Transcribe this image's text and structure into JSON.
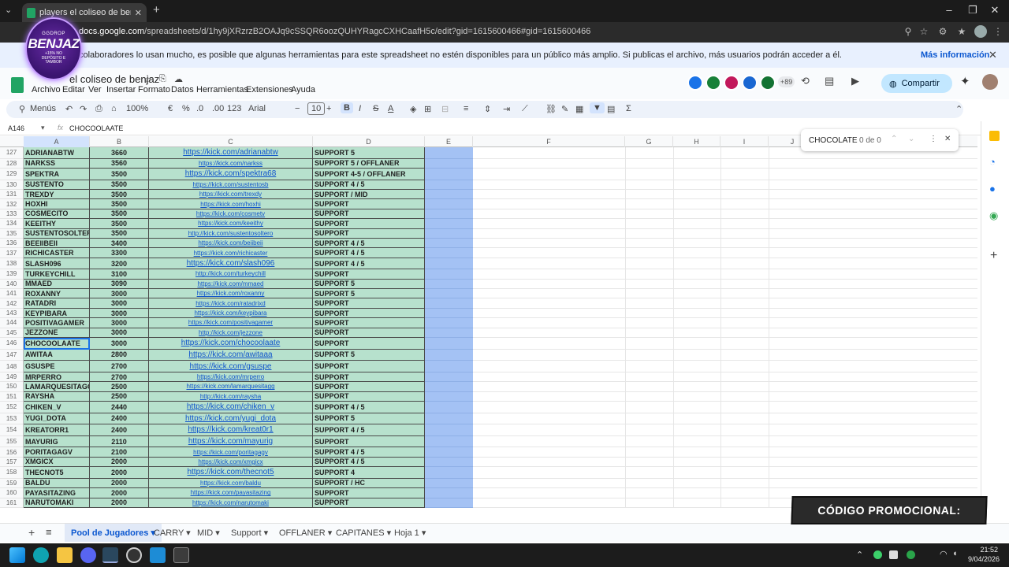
{
  "browser": {
    "tab_title": "players el coliseo de benjaz - Hoja",
    "url_host": "docs.google.com",
    "url_path": "/spreadsheets/d/1hy9jXRzrzB2OAJq9cSSQR6oozQUHYRagcCXHCaafH5c/edit?gid=1615600466#gid=1615600466"
  },
  "banner": {
    "message": "colaboradores lo usan mucho, es posible que algunas herramientas para este spreadsheet no estén disponibles para un público más amplio. Si publicas el archivo, más usuarios podrán acceder a él.",
    "more_link": "Más información"
  },
  "doc": {
    "title": "el coliseo de benjaz",
    "menus": [
      "Archivo",
      "Editar",
      "Ver",
      "Insertar",
      "Formato",
      "Datos",
      "Herramientas",
      "Extensiones",
      "Ayuda"
    ],
    "presence_more": "+89",
    "share_label": "Compartir"
  },
  "toolbar": {
    "menus_label": "Menús",
    "zoom": "100%",
    "currency": "€",
    "percent": "%",
    "dec_less": ".0",
    "dec_more": ".00",
    "format123": "123",
    "font": "Arial",
    "font_size": "10"
  },
  "formula": {
    "cell_ref": "A146",
    "value": "CHOCOOLAATE"
  },
  "columns": [
    "A",
    "B",
    "C",
    "D",
    "E",
    "F",
    "G",
    "H",
    "I",
    "J"
  ],
  "find": {
    "query": "CHOCOLATE",
    "count": "0 de 0"
  },
  "rows": [
    {
      "n": "127",
      "a": "ADRIANABTW",
      "b": "3660",
      "c": "https://kick.com/adrianabtw",
      "d": "SUPPORT 5",
      "big": true
    },
    {
      "n": "128",
      "a": "NARKSS",
      "b": "3560",
      "c": "https://kick.com/narkss",
      "d": "SUPPORT 5 / OFFLANER",
      "big": false
    },
    {
      "n": "129",
      "a": "SPEKTRA",
      "b": "3500",
      "c": "https://kick.com/spektra68",
      "d": "SUPPORT 4-5 / OFFLANER",
      "big": true
    },
    {
      "n": "130",
      "a": "SUSTENTO",
      "b": "3500",
      "c": "https://kick.com/sustentosb",
      "d": "SUPPORT 4 / 5",
      "big": false
    },
    {
      "n": "131",
      "a": "TREXDY",
      "b": "3500",
      "c": "https://kick.com/trexdy",
      "d": "SUPPORT / MID",
      "big": false
    },
    {
      "n": "132",
      "a": "HOXHI",
      "b": "3500",
      "c": "https://kick.com/hoxhi",
      "d": "SUPPORT",
      "big": false
    },
    {
      "n": "133",
      "a": "COSMECITO",
      "b": "3500",
      "c": "https://kick.com/cosmetv",
      "d": "SUPPORT",
      "big": false
    },
    {
      "n": "134",
      "a": "KEEITHY",
      "b": "3500",
      "c": "https://kick.com/keeithy",
      "d": "SUPPORT",
      "big": false
    },
    {
      "n": "135",
      "a": "SUSTENTOSOLTERO",
      "b": "3500",
      "c": "http://kick.com/sustentosoltero",
      "d": "SUPPORT",
      "big": false
    },
    {
      "n": "136",
      "a": "BEEIIBEII",
      "b": "3400",
      "c": "https://kick.com/beiibeii",
      "d": "SUPPORT 4 / 5",
      "big": false
    },
    {
      "n": "137",
      "a": "RICHICASTER",
      "b": "3300",
      "c": "https://kick.com/richicaster",
      "d": "SUPPORT 4 / 5",
      "big": false
    },
    {
      "n": "138",
      "a": "SLASH096",
      "b": "3200",
      "c": "https://kick.com/slash096",
      "d": "SUPPORT 4 / 5",
      "big": true
    },
    {
      "n": "139",
      "a": "TURKEYCHILL",
      "b": "3100",
      "c": "http://kick.com/turkeychill",
      "d": "SUPPORT",
      "big": false
    },
    {
      "n": "140",
      "a": "MMAED",
      "b": "3090",
      "c": "https://kick.com/mmaed",
      "d": "SUPPORT 5",
      "big": false
    },
    {
      "n": "141",
      "a": "ROXANNY",
      "b": "3000",
      "c": "https://kick.com/roxanny",
      "d": "SUPPORT 5",
      "big": false
    },
    {
      "n": "142",
      "a": "RATADRI",
      "b": "3000",
      "c": "https://kick.com/ratadrixd",
      "d": "SUPPORT",
      "big": false
    },
    {
      "n": "143",
      "a": "KEYPIBARA",
      "b": "3000",
      "c": "https://kick.com/keypibara",
      "d": "SUPPORT",
      "big": false
    },
    {
      "n": "144",
      "a": "POSITIVAGAMER",
      "b": "3000",
      "c": "https://kick.com/positivagamer",
      "d": "SUPPORT",
      "big": false
    },
    {
      "n": "145",
      "a": "JEZZONE",
      "b": "3000",
      "c": "http://kick.com/jezzone",
      "d": "SUPPORT",
      "big": false
    },
    {
      "n": "146",
      "a": "CHOCOOLAATE",
      "b": "3000",
      "c": "https://kick.com/chocoolaate",
      "d": "SUPPORT",
      "big": true,
      "selected": true
    },
    {
      "n": "147",
      "a": "AWITAA",
      "b": "2800",
      "c": "https://kick.com/awitaaa",
      "d": "SUPPORT 5",
      "big": true
    },
    {
      "n": "148",
      "a": "GSUSPE",
      "b": "2700",
      "c": "https://kick.com/gsuspe",
      "d": "SUPPORT",
      "big": true
    },
    {
      "n": "149",
      "a": "MRPERRO",
      "b": "2700",
      "c": "https://kick.com/mrperro",
      "d": "SUPPORT",
      "big": false
    },
    {
      "n": "150",
      "a": "LAMARQUESITAGG",
      "b": "2500",
      "c": "https://kick.com/lamarquesitagg",
      "d": "SUPPORT",
      "big": false
    },
    {
      "n": "151",
      "a": "RAYSHA",
      "b": "2500",
      "c": "http://kick.com/raysha",
      "d": "SUPPORT",
      "big": false
    },
    {
      "n": "152",
      "a": "CHIKEN_V",
      "b": "2440",
      "c": "https://kick.com/chiken_v",
      "d": "SUPPORT 4 / 5",
      "big": true
    },
    {
      "n": "153",
      "a": "YUGI_DOTA",
      "b": "2400",
      "c": "https://kick.com/yugi_dota",
      "d": "SUPPORT 5",
      "big": true
    },
    {
      "n": "154",
      "a": "KREATORR1",
      "b": "2400",
      "c": "https://kick.com/kreat0r1",
      "d": "SUPPORT 4 / 5",
      "big": true
    },
    {
      "n": "155",
      "a": "MAYURIG",
      "b": "2110",
      "c": "https://kick.com/mayurig",
      "d": "SUPPORT",
      "big": true
    },
    {
      "n": "156",
      "a": "PORITAGAGV",
      "b": "2100",
      "c": "https://kick.com/poritagagv",
      "d": "SUPPORT 4 / 5",
      "big": false
    },
    {
      "n": "157",
      "a": "XMGICX",
      "b": "2000",
      "c": "https://kick.com/xmgicx",
      "d": "SUPPORT 4 / 5",
      "big": false
    },
    {
      "n": "158",
      "a": "THECNOT5",
      "b": "2000",
      "c": "https://kick.com/thecnot5",
      "d": "SUPPORT 4",
      "big": true
    },
    {
      "n": "159",
      "a": "BALDU",
      "b": "2000",
      "c": "https://kick.com/baldu",
      "d": "SUPPORT / HC",
      "big": false
    },
    {
      "n": "160",
      "a": "PAYASITAZING",
      "b": "2000",
      "c": "https://kick.com/payasitazing",
      "d": "SUPPORT",
      "big": false
    },
    {
      "n": "161",
      "a": "NARUTOMAKI",
      "b": "2000",
      "c": "https://kick.com/narutomaki",
      "d": "SUPPORT",
      "big": false
    }
  ],
  "sheet_tabs": [
    "Pool de Jugadores",
    "CARRY",
    "MID",
    "Support",
    "OFFLANER",
    "CAPITANES",
    "Hoja 1"
  ],
  "taskbar": {
    "time": "21:52",
    "date": "9/04/2026"
  },
  "overlay": {
    "logo_top": "GGDROP",
    "logo_main": "BENJAZ",
    "logo_sub": "+15% NO DEPÓSITO E TAMBOR",
    "promo": "CÓDIGO PROMOCIONAL:"
  },
  "colors": {
    "green_cell": "#b7e1cd",
    "blue_col": "#a4c2f4",
    "link": "#1155cc",
    "accent": "#0b57d0"
  }
}
